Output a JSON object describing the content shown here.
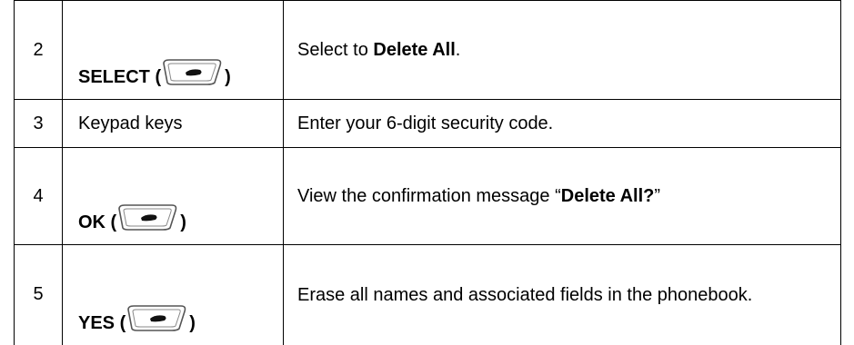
{
  "rows": [
    {
      "step": "2",
      "action": {
        "label": "SELECT (",
        "close": ")",
        "icon": "soft-key-icon"
      },
      "description": {
        "before": "Select to ",
        "bold": "Delete All",
        "after": "."
      }
    },
    {
      "step": "3",
      "action": {
        "label": "Keypad keys"
      },
      "description": {
        "text": "Enter your 6-digit security code."
      }
    },
    {
      "step": "4",
      "action": {
        "label": "OK (",
        "close": ")",
        "icon": "soft-key-icon"
      },
      "description": {
        "before": "View the confirmation message “",
        "bold": "Delete All?",
        "after": "”"
      }
    },
    {
      "step": "5",
      "action": {
        "label": "YES (",
        "close": ")",
        "icon": "soft-key-icon"
      },
      "description": {
        "text": "Erase all names and associated fields in the phonebook."
      }
    }
  ]
}
